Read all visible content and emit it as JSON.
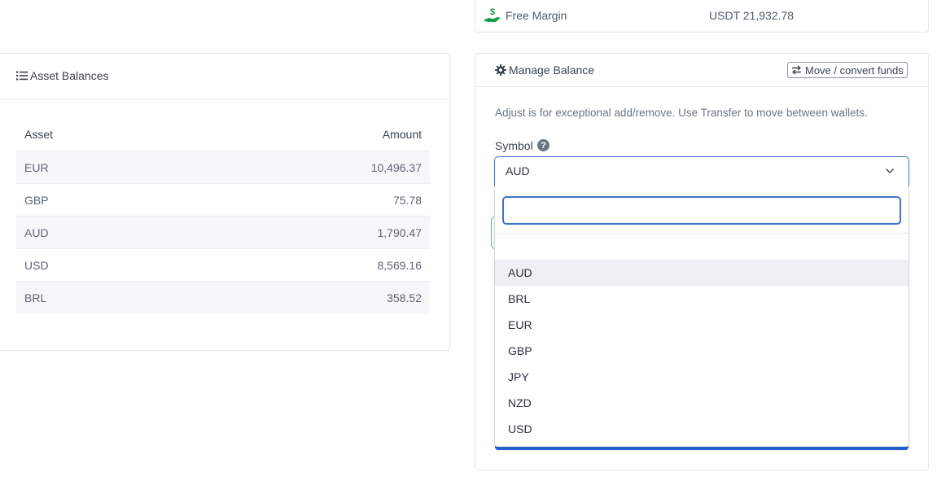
{
  "free_margin": {
    "label": "Free Margin",
    "value": "USDT 21,932.78",
    "icon": "hand-dollar-icon",
    "icon_color": "#1e9e4a"
  },
  "asset_balances": {
    "title": "Asset Balances",
    "icon": "list-icon",
    "columns": {
      "asset": "Asset",
      "amount": "Amount"
    },
    "rows": [
      {
        "asset": "EUR",
        "amount": "10,496.37"
      },
      {
        "asset": "GBP",
        "amount": "75.78"
      },
      {
        "asset": "AUD",
        "amount": "1,790.47"
      },
      {
        "asset": "USD",
        "amount": "8,569.16"
      },
      {
        "asset": "BRL",
        "amount": "358.52"
      }
    ]
  },
  "manage_balance": {
    "title": "Manage Balance",
    "icon": "gear-icon",
    "move_button": "Move / convert funds",
    "move_icon": "exchange-icon",
    "note": "Adjust is for exceptional add/remove. Use Transfer to move between wallets.",
    "symbol_label": "Symbol",
    "help_glyph": "?",
    "selected_symbol": "AUD",
    "search_value": "",
    "options": [
      "AUD",
      "BRL",
      "EUR",
      "GBP",
      "JPY",
      "NZD",
      "USD"
    ],
    "highlighted_option": "AUD",
    "accent_color": "#3d74c6"
  }
}
